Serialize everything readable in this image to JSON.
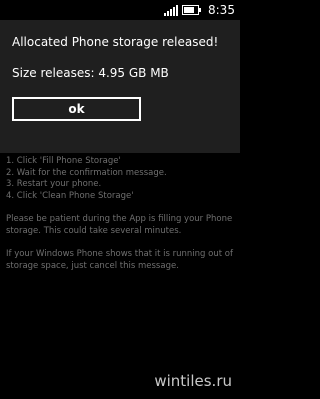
{
  "status_bar": {
    "time": "8:35",
    "icons": [
      "signal-icon",
      "battery-icon"
    ],
    "battery_level": 0.8
  },
  "dialog": {
    "title": "Allocated Phone storage released!",
    "message": "Size releases: 4.95 GB MB",
    "ok_label": "ok"
  },
  "instructions": {
    "steps": [
      "1. Click 'Fill Phone Storage'",
      "2. Wait for the confirmation message.",
      "3. Restart your phone.",
      "4. Click 'Clean Phone Storage'"
    ],
    "patience_note": "Please be patient during the App is filling your Phone storage. This could take several minutes.",
    "cancel_note": "If your Windows Phone shows that it is running out of storage space, just cancel this message."
  },
  "watermark": "wintiles.ru",
  "colors": {
    "background": "#000000",
    "dialog_background": "#1f1f1f",
    "text": "#ffffff",
    "muted_text": "#6f6f6f"
  }
}
